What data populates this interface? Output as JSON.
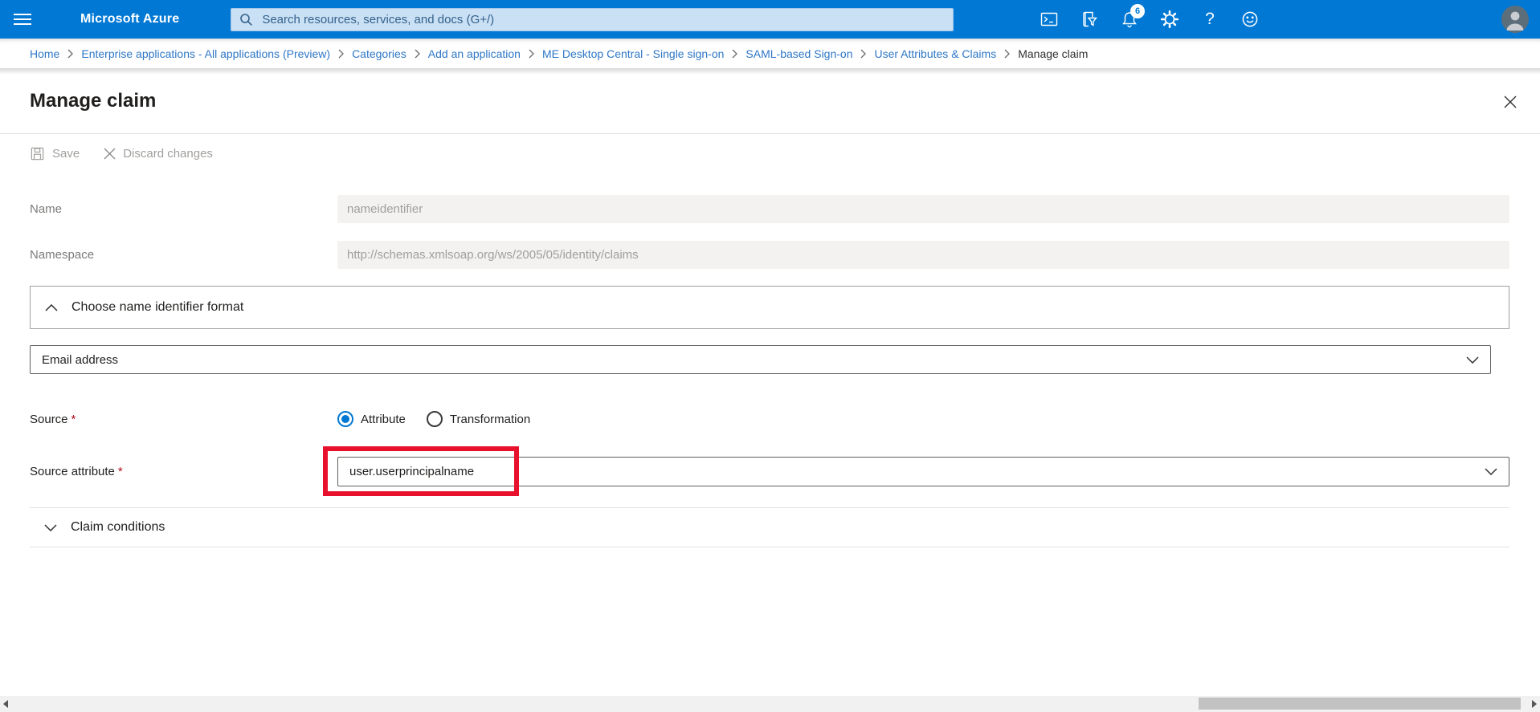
{
  "topbar": {
    "brand": "Microsoft Azure",
    "search_placeholder": "Search resources, services, and docs (G+/)",
    "notification_badge": "6",
    "help_glyph": "?"
  },
  "breadcrumb": {
    "items": [
      {
        "label": "Home"
      },
      {
        "label": "Enterprise applications - All applications (Preview)"
      },
      {
        "label": "Categories"
      },
      {
        "label": "Add an application"
      },
      {
        "label": "ME Desktop Central - Single sign-on"
      },
      {
        "label": "SAML-based Sign-on"
      },
      {
        "label": "User Attributes & Claims"
      },
      {
        "label": "Manage claim"
      }
    ]
  },
  "blade": {
    "title": "Manage claim"
  },
  "toolbar": {
    "save_label": "Save",
    "discard_label": "Discard changes"
  },
  "form": {
    "name_label": "Name",
    "name_value": "nameidentifier",
    "namespace_label": "Namespace",
    "namespace_value": "http://schemas.xmlsoap.org/ws/2005/05/identity/claims",
    "identifier_format_section": "Choose name identifier format",
    "identifier_format_value": "Email address",
    "source_label": "Source",
    "required_mark": "*",
    "source_options": [
      {
        "label": "Attribute",
        "selected": true
      },
      {
        "label": "Transformation",
        "selected": false
      }
    ],
    "source_attribute_label": "Source attribute",
    "source_attribute_value": "user.userprincipalname",
    "claim_conditions_label": "Claim conditions"
  },
  "colors": {
    "topbar": "#0078d4",
    "accent": "#0078d4",
    "annotation_red": "#e8112d",
    "breadcrumb_link": "#2e77c6",
    "disabled_text": "#a19f9d"
  }
}
